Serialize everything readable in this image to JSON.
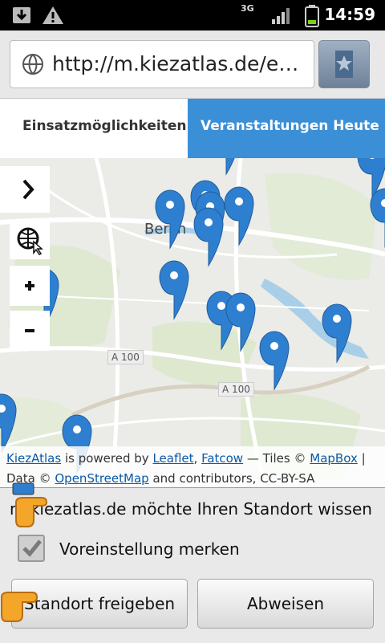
{
  "status_bar": {
    "time": "14:59",
    "network": "3G",
    "icons": [
      "download-icon",
      "warning-icon",
      "signal-icon",
      "battery-icon"
    ]
  },
  "browser": {
    "url": "http://m.kiezatlas.de/ehr...",
    "bookmark_icon": "star-bookmark-icon"
  },
  "tabs": [
    {
      "label": "Einsatzmöglichkeiten",
      "active": true
    },
    {
      "label": "Veranstaltungen Heute",
      "active": false
    }
  ],
  "map": {
    "city_label": "Berlin",
    "road_labels": [
      "A 100",
      "A 100"
    ],
    "controls": [
      "chevron-right-icon",
      "globe-cursor-icon",
      "zoom-in-icon",
      "zoom-out-icon"
    ],
    "attribution": {
      "kiezatlas": "KiezAtlas",
      "powered": "is powered by",
      "leaflet": "Leaflet",
      "fatcow": "Fatcow",
      "tiles": "— Tiles ©",
      "mapbox": "MapBox",
      "sep": "|",
      "data": "Data ©",
      "osm": "OpenStreetMap",
      "rest": "and contributors, CC-BY-SA"
    },
    "accent": "#3b8fd6"
  },
  "dialog": {
    "message": "m.kiezatlas.de möchte Ihren Standort wissen",
    "remember_label": "Voreinstellung merken",
    "remember_checked": true,
    "allow_label": "Standort freigeben",
    "deny_label": "Abweisen"
  }
}
